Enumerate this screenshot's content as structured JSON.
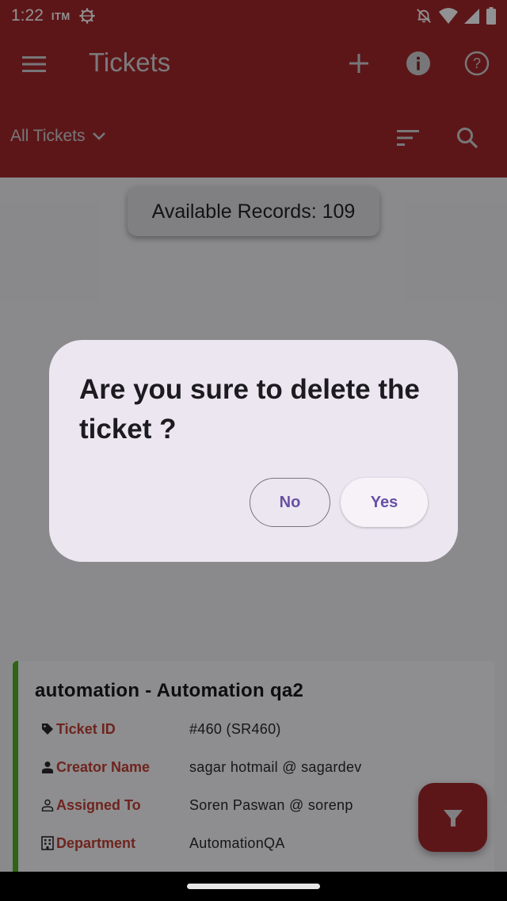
{
  "status_bar": {
    "time": "1:22",
    "carrier": "ITM",
    "icons": [
      "settings-gear-icon",
      "notifications-off-icon",
      "wifi-icon",
      "signal-icon",
      "battery-icon"
    ]
  },
  "app_bar": {
    "title": "Tickets",
    "menu_icon": "hamburger-menu-icon",
    "actions": [
      "add-icon",
      "info-icon",
      "help-icon"
    ],
    "filter_label": "All Tickets",
    "filter_icon": "chevron-down-icon",
    "secondary_actions": [
      "sort-icon",
      "search-icon"
    ]
  },
  "records_toast": {
    "text": "Available Records: 109"
  },
  "ticket": {
    "title": "automation - Automation qa2",
    "status_color": "#4caf1a",
    "fields": [
      {
        "icon": "tag-icon",
        "label": "Ticket ID",
        "value": "#460  (SR460)"
      },
      {
        "icon": "person-icon",
        "label": "Creator Name",
        "value": "sagar hotmail @ sagardev"
      },
      {
        "icon": "person-outline-icon",
        "label": "Assigned To",
        "value": "Soren Paswan @ sorenp"
      },
      {
        "icon": "building-icon",
        "label": "Department",
        "value": "AutomationQA"
      }
    ]
  },
  "fab": {
    "icon": "filter-icon"
  },
  "dialog": {
    "message": "Are you sure to delete the ticket ?",
    "no_label": "No",
    "yes_label": "Yes"
  },
  "colors": {
    "brand": "#a01f1f",
    "dialog_accent": "#6750a4",
    "label_red": "#c0392b"
  }
}
